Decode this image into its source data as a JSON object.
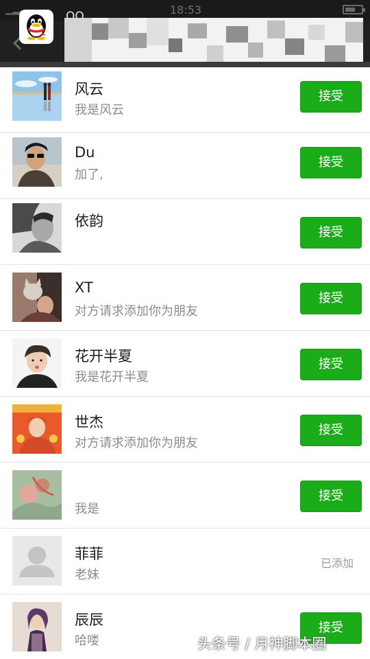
{
  "status_bar": {
    "signal": "▁▂▃",
    "time": "18:53"
  },
  "header": {
    "title": "QQ"
  },
  "colors": {
    "accept_green": "#1aad19",
    "header_dark": "#202020"
  },
  "requests": [
    {
      "name": "风云",
      "message": "我是风云",
      "action": "接受",
      "avatar": "landscape-avatar"
    },
    {
      "name": "Du",
      "message": "加了,",
      "action": "接受",
      "avatar": "man-sunglasses-avatar"
    },
    {
      "name": "依韵",
      "message": "",
      "action": "接受",
      "avatar": "portrait-avatar"
    },
    {
      "name": "XT",
      "message": "对方请求添加你为朋友",
      "action": "接受",
      "avatar": "cat-photo-avatar"
    },
    {
      "name": "花开半夏",
      "message": "我是花开半夏",
      "action": "接受",
      "avatar": "boy-photo-avatar"
    },
    {
      "name": "世杰",
      "message": "对方请求添加你为朋友",
      "action": "接受",
      "avatar": "new-year-avatar"
    },
    {
      "name": "",
      "message": "我是",
      "action": "接受",
      "avatar": "painting-avatar"
    },
    {
      "name": "菲菲",
      "message": "老妹",
      "status": "已添加",
      "avatar": "default-user-avatar"
    },
    {
      "name": "辰辰",
      "message": "哈喽",
      "action": "接受",
      "avatar": "girl-photo-avatar"
    }
  ],
  "watermark": "头条号 / 月神脚本圈"
}
